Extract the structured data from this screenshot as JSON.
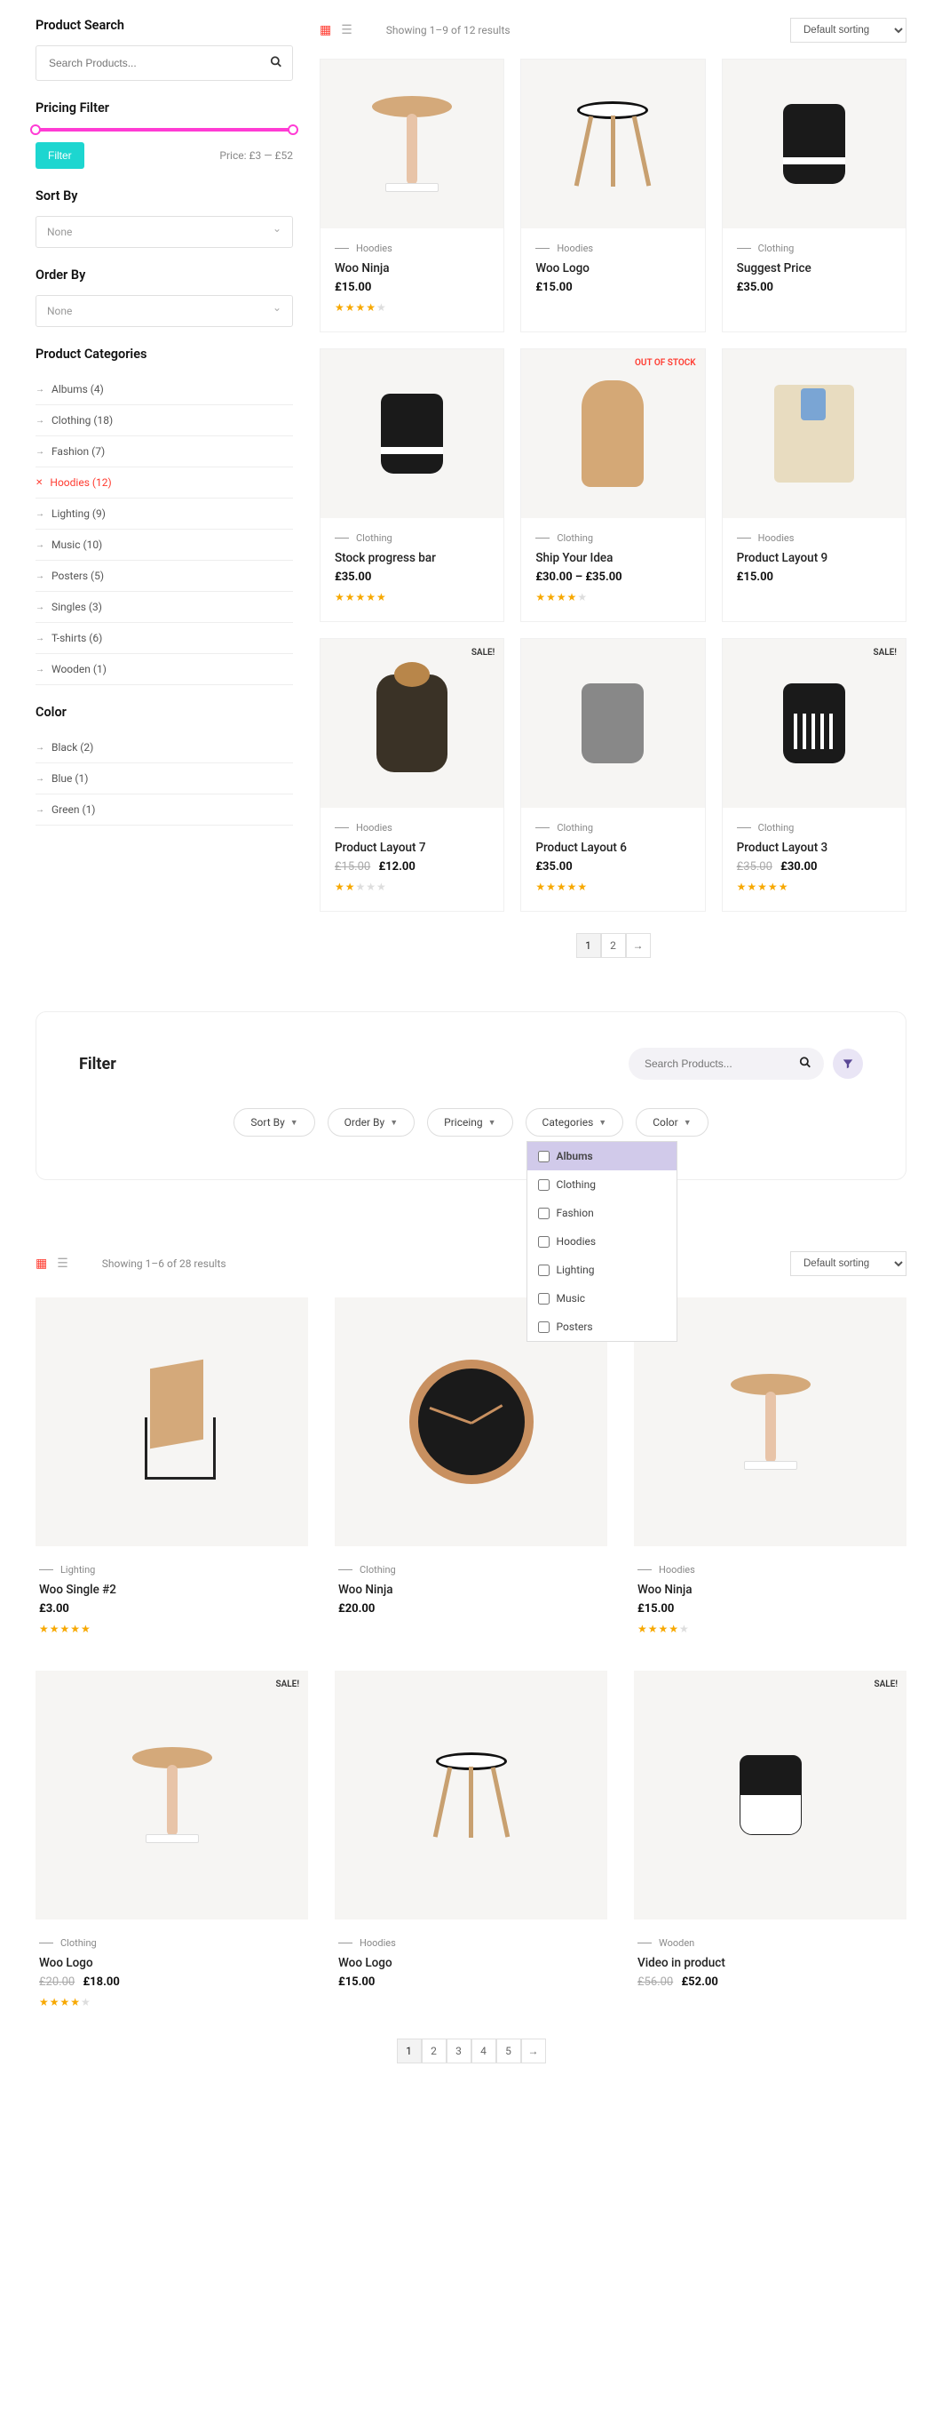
{
  "section1": {
    "sidebar": {
      "search_title": "Product Search",
      "search_placeholder": "Search Products...",
      "pricing_title": "Pricing Filter",
      "filter_btn": "Filter",
      "price_range": "Price: £3 — £52",
      "sortby_title": "Sort By",
      "sortby_value": "None",
      "orderby_title": "Order By",
      "orderby_value": "None",
      "cats_title": "Product Categories",
      "cats": [
        {
          "label": "Albums (4)",
          "active": false
        },
        {
          "label": "Clothing (18)",
          "active": false
        },
        {
          "label": "Fashion (7)",
          "active": false
        },
        {
          "label": "Hoodies (12)",
          "active": true
        },
        {
          "label": "Lighting (9)",
          "active": false
        },
        {
          "label": "Music (10)",
          "active": false
        },
        {
          "label": "Posters (5)",
          "active": false
        },
        {
          "label": "Singles (3)",
          "active": false
        },
        {
          "label": "T-shirts (6)",
          "active": false
        },
        {
          "label": "Wooden (1)",
          "active": false
        }
      ],
      "color_title": "Color",
      "colors": [
        {
          "label": "Black (2)"
        },
        {
          "label": "Blue (1)"
        },
        {
          "label": "Green (1)"
        }
      ]
    },
    "topbar": {
      "results": "Showing 1–9 of 12 results",
      "sort": "Default sorting"
    },
    "products": [
      {
        "cat": "Hoodies",
        "title": "Woo Ninja",
        "price": "£15.00",
        "rating": 4,
        "img": "table"
      },
      {
        "cat": "Hoodies",
        "title": "Woo Logo",
        "price": "£15.00",
        "img": "stool"
      },
      {
        "cat": "Clothing",
        "title": "Suggest Price",
        "price": "£35.00",
        "img": "bag-band"
      },
      {
        "cat": "Clothing",
        "title": "Stock progress bar",
        "price": "£35.00",
        "rating": 5,
        "img": "bag-band"
      },
      {
        "cat": "Clothing",
        "title": "Ship Your Idea",
        "price": "£30.00 – £35.00",
        "rating": 4,
        "img": "coat",
        "badge": "oos",
        "badge_txt": "OUT OF STOCK"
      },
      {
        "cat": "Hoodies",
        "title": "Product Layout 9",
        "price": "£15.00",
        "img": "blazer"
      },
      {
        "cat": "Hoodies",
        "title": "Product Layout 7",
        "old": "£15.00",
        "price": "£12.00",
        "rating": 2,
        "img": "jacket",
        "badge": "sale",
        "badge_txt": "SALE!"
      },
      {
        "cat": "Clothing",
        "title": "Product Layout 6",
        "price": "£35.00",
        "rating": 4.5,
        "img": "bag-gray"
      },
      {
        "cat": "Clothing",
        "title": "Product Layout 3",
        "old": "£35.00",
        "price": "£30.00",
        "rating": 4.5,
        "img": "bag-stripe",
        "badge": "sale",
        "badge_txt": "SALE!"
      }
    ],
    "pagination": [
      "1",
      "2",
      "→"
    ]
  },
  "section2": {
    "title": "Filter",
    "search_placeholder": "Search Products...",
    "pills": [
      {
        "label": "Sort By"
      },
      {
        "label": "Order By"
      },
      {
        "label": "Priceing"
      },
      {
        "label": "Categories",
        "open": true
      },
      {
        "label": "Color"
      }
    ],
    "dropdown": [
      "Albums",
      "Clothing",
      "Fashion",
      "Hoodies",
      "Lighting",
      "Music",
      "Posters"
    ],
    "topbar": {
      "results": "Showing 1–6 of 28 results",
      "sort": "Default sorting"
    },
    "products": [
      {
        "cat": "Lighting",
        "title": "Woo Single #2",
        "price": "£3.00",
        "rating": 4.5,
        "img": "chair"
      },
      {
        "cat": "Clothing",
        "title": "Woo Ninja",
        "price": "£20.00",
        "img": "clock"
      },
      {
        "cat": "Hoodies",
        "title": "Woo Ninja",
        "price": "£15.00",
        "rating": 4,
        "img": "table"
      },
      {
        "cat": "Clothing",
        "title": "Woo Logo",
        "old": "£20.00",
        "price": "£18.00",
        "rating": 4,
        "img": "table",
        "badge": "sale",
        "badge_txt": "SALE!"
      },
      {
        "cat": "Hoodies",
        "title": "Woo Logo",
        "price": "£15.00",
        "img": "stool"
      },
      {
        "cat": "Wooden",
        "title": "Video in product",
        "old": "£56.00",
        "price": "£52.00",
        "img": "bag-half",
        "badge": "sale",
        "badge_txt": "SALE!"
      }
    ],
    "pagination": [
      "1",
      "2",
      "3",
      "4",
      "5",
      "→"
    ]
  }
}
